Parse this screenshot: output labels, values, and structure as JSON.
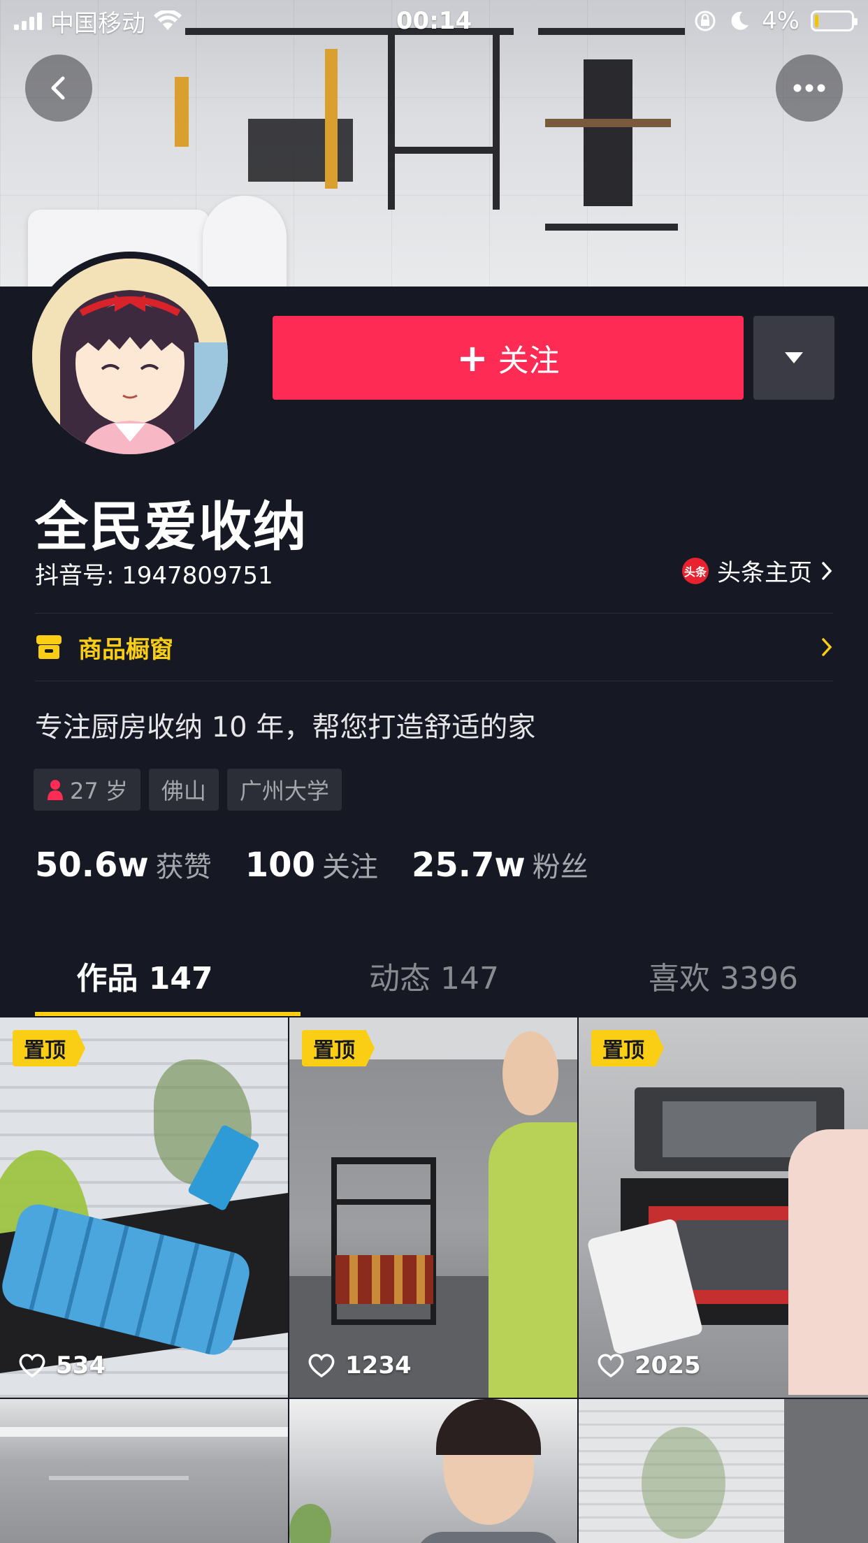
{
  "status_bar": {
    "carrier": "中国移动",
    "time": "00:14",
    "battery": "4%",
    "battery_level": 0.04
  },
  "profile": {
    "name": "全民爱收纳",
    "douyin_id": "抖音号: 1947809751",
    "toutiao_link": "头条主页",
    "toutiao_logo_text": "头条",
    "follow_label": "关注",
    "follow_plus": "+",
    "shop_label": "商品橱窗",
    "bio": "专注厨房收纳 10 年，帮您打造舒适的家",
    "tags": [
      {
        "label": "27 岁",
        "icon": "female-icon"
      },
      {
        "label": "佛山"
      },
      {
        "label": "广州大学"
      }
    ],
    "stats": [
      {
        "num": "50.6w",
        "label": "获赞"
      },
      {
        "num": "100",
        "label": "关注"
      },
      {
        "num": "25.7w",
        "label": "粉丝"
      }
    ]
  },
  "tabs": [
    {
      "label": "作品 147",
      "active": true
    },
    {
      "label": "动态 147",
      "active": false
    },
    {
      "label": "喜欢 3396",
      "active": false
    }
  ],
  "videos": [
    {
      "pinned": "置顶",
      "likes": "534"
    },
    {
      "pinned": "置顶",
      "likes": "1234"
    },
    {
      "pinned": "置顶",
      "likes": "2025"
    }
  ],
  "colors": {
    "background": "#161823",
    "follow": "#fe2c55",
    "accent": "#face15"
  }
}
